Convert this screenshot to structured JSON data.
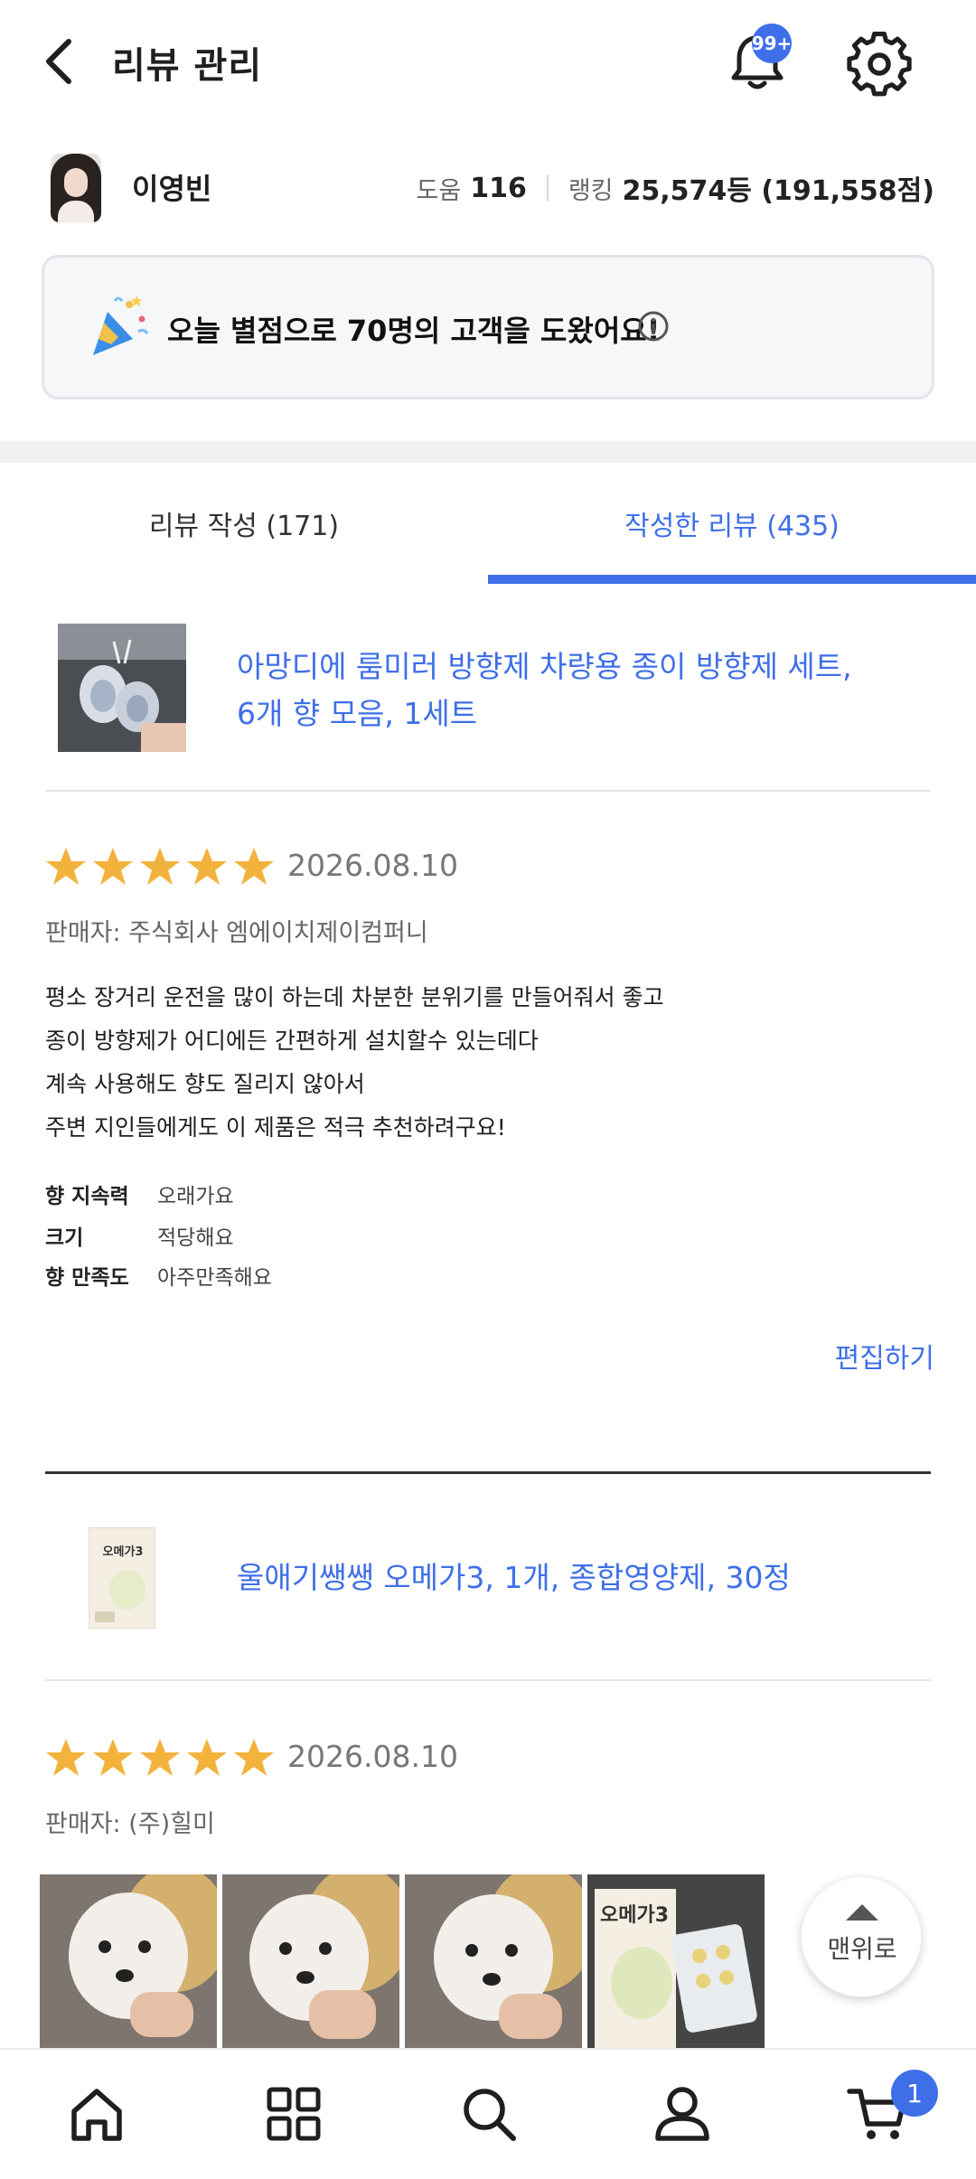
{
  "header": {
    "title": "리뷰 관리",
    "notification_badge": "99+"
  },
  "profile": {
    "name": "이영빈",
    "help_label": "도움",
    "help_count": "116",
    "ranking_label": "랭킹",
    "ranking_value": "25,574등 (191,558점)"
  },
  "notice": {
    "text": "오늘 별점으로 70명의 고객을 도왔어요!"
  },
  "tabs": [
    {
      "label": "리뷰 작성 (171)",
      "active": false
    },
    {
      "label": "작성한 리뷰 (435)",
      "active": true
    }
  ],
  "reviews": [
    {
      "product_line1": "아망디에 룸미러 방향제 차량용 종이 방향제 세트,",
      "product_line2": "6개 향 모음, 1세트",
      "rating": 5,
      "date": "2026.08.10",
      "seller": "판매자: 주식회사 엠에이치제이컴퍼니",
      "body": [
        "평소 장거리 운전을 많이 하는데 차분한 분위기를 만들어줘서 좋고",
        "종이 방향제가 어디에든 간편하게 설치할수 있는데다",
        "계속 사용해도 향도 질리지 않아서",
        "주변 지인들에게도 이 제품은 적극 추천하려구요!"
      ],
      "attributes": [
        {
          "label": "향 지속력",
          "value": "오래가요"
        },
        {
          "label": "크기",
          "value": "적당해요"
        },
        {
          "label": "향 만족도",
          "value": "아주만족해요"
        }
      ],
      "edit_label": "편집하기"
    },
    {
      "product_line1": "울애기쌩쌩 오메가3, 1개, 종합영양제, 30정",
      "thumb_text": "오메가3",
      "rating": 5,
      "date": "2026.08.10",
      "seller": "판매자: (주)힐미",
      "photo_label": "오메가3"
    }
  ],
  "scroll_top_label": "맨위로",
  "bottom_nav": {
    "items": [
      "home-icon",
      "category-icon",
      "search-icon",
      "user-icon",
      "cart-icon"
    ],
    "cart_badge": "1"
  },
  "colors": {
    "accent": "#3f6fe8",
    "star": "#f3b23b"
  }
}
